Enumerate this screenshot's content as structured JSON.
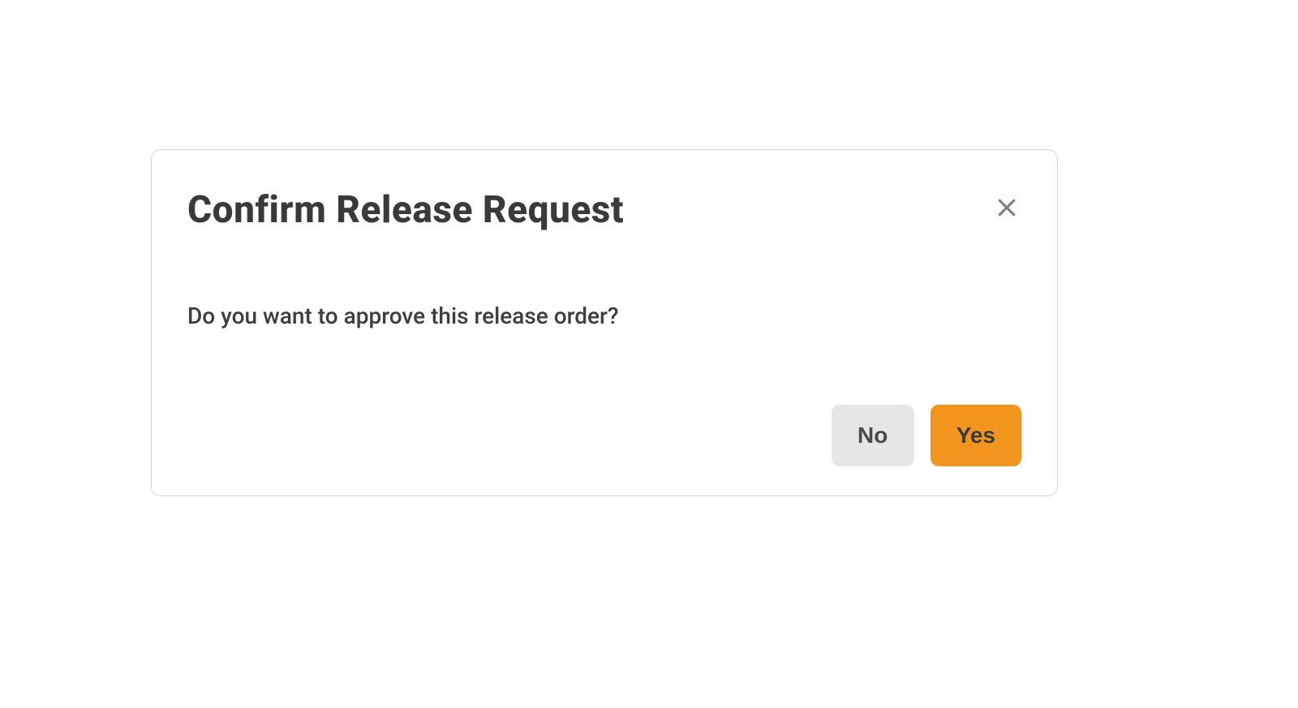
{
  "dialog": {
    "title": "Confirm Release Request",
    "message": "Do you want to approve this release order?",
    "buttons": {
      "no": "No",
      "yes": "Yes"
    },
    "close_icon": "close-icon"
  },
  "colors": {
    "accent": "#f2951e",
    "neutral_button": "#e6e6e6",
    "text_dark": "#3a3a3a",
    "border": "#d5d5d5"
  }
}
